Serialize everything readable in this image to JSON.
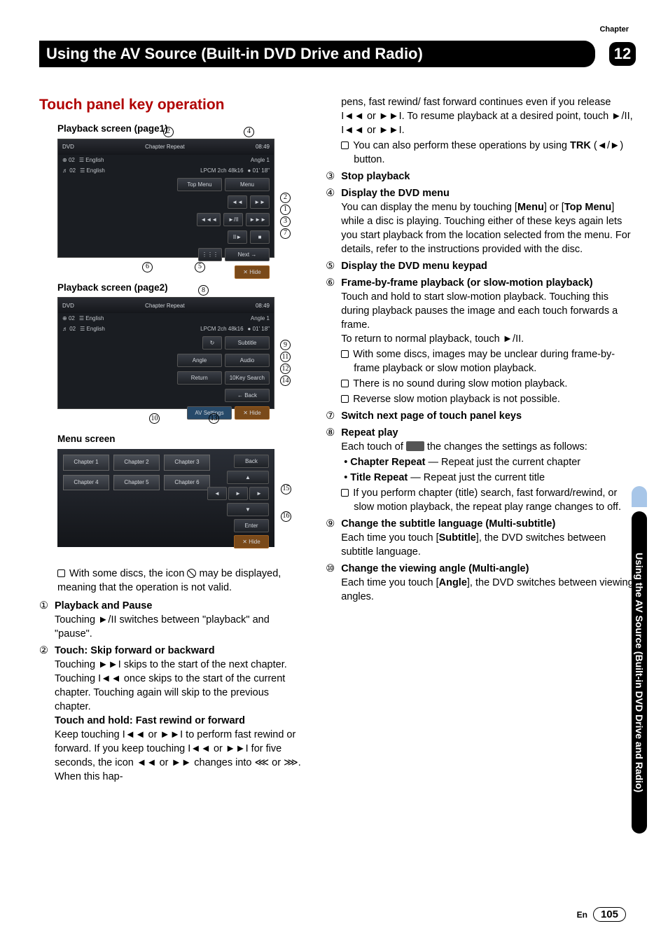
{
  "chapterLabel": "Chapter",
  "chapterNum": "12",
  "headerTitle": "Using the AV Source (Built-in DVD Drive and Radio)",
  "sectionTitle": "Touch panel key operation",
  "captions": {
    "p1": "Playback screen (page1)",
    "p2": "Playback screen (page2)",
    "menu": "Menu screen"
  },
  "panel1": {
    "dvd": "DVD",
    "c1a": "02",
    "c1b": "English",
    "c2a": "02",
    "c2b": "English",
    "chapter": "Chapter",
    "repeat": "Repeat",
    "time": "08:49",
    "angle": "Angle 1",
    "codec": "LPCM 2ch 48k16",
    "dur": "01' 18\"",
    "topmenu": "Top Menu",
    "menu": "Menu",
    "prev": "◄◄",
    "next": "►►",
    "rew": "◄◄◄",
    "play": "►/II",
    "fwd": "►►►",
    "slow": "II►",
    "stop": "■",
    "keypad": "⋮⋮⋮",
    "nextpage": "Next →",
    "hide": "✕ Hide"
  },
  "panel2": {
    "subtitle": "Subtitle",
    "angleBtn": "Angle",
    "audio": "Audio",
    "return": "Return",
    "search": "10Key Search",
    "back": "← Back",
    "av": "AV Settings",
    "hide": "✕ Hide",
    "repeatBtn": "↻"
  },
  "menuPanel": {
    "c1": "Chapter\n1",
    "c2": "Chapter\n2",
    "c3": "Chapter\n3",
    "c4": "Chapter\n4",
    "c5": "Chapter\n5",
    "c6": "Chapter\n6",
    "back": "Back",
    "enter": "Enter",
    "hide": "✕ Hide",
    "up": "▲",
    "down": "▼",
    "left": "◄",
    "right": "►",
    "ok": "►"
  },
  "leftBody": {
    "invalid": "With some discs, the icon ",
    "invalid2": " may be displayed, meaning that the operation is not valid.",
    "i1t": "Playback and Pause",
    "i1b": "Touching ►/II switches between \"playback\" and \"pause\".",
    "i2t": "Touch: Skip forward or backward",
    "i2b1": "Touching ►►I skips to the start of the next chapter. Touching I◄◄ once skips to the start of the current chapter. Touching again will skip to the previous chapter.",
    "i2t2": "Touch and hold: Fast rewind or forward",
    "i2b2": "Keep touching I◄◄ or ►►I to perform fast rewind or forward. If you keep touching I◄◄ or ►►I for five seconds, the icon ◄◄ or ►► changes into ⋘ or ⋙. When this hap-"
  },
  "rightBody": {
    "cont": "pens, fast rewind/ fast forward continues even if you release I◄◄ or ►►I. To resume playback at a desired point, touch ►/II, I◄◄ or ►►I.",
    "trk": "You can also perform these operations by using ",
    "trkB": "TRK",
    "trk2": " (◄/►) button.",
    "i3": "Stop playback",
    "i4t": "Display the DVD menu",
    "i4b": "You can display the menu by touching [",
    "i4menu": "Menu",
    "i4mid": "] or [",
    "i4top": "Top Menu",
    "i4b2": "] while a disc is playing. Touching either of these keys again lets you start playback from the location selected from the menu. For details, refer to the instructions provided with the disc.",
    "i5": "Display the DVD menu keypad",
    "i6t": "Frame-by-frame playback (or slow-motion playback)",
    "i6b": "Touch and hold to start slow-motion playback. Touching this during playback pauses the image and each touch forwards a frame.",
    "i6b2": "To return to normal playback, touch ►/II.",
    "i6s1": "With some discs, images may be unclear during frame-by-frame playback or slow motion playback.",
    "i6s2": "There is no sound during slow motion playback.",
    "i6s3": "Reverse slow motion playback is not possible.",
    "i7": "Switch next page of touch panel keys",
    "i8t": "Repeat play",
    "i8b": "Each touch of ",
    "i8b2": " the changes the settings as follows:",
    "i8c1": "Chapter Repeat",
    "i8c1b": " — Repeat just the current chapter",
    "i8c2": "Title Repeat",
    "i8c2b": " — Repeat just the current title",
    "i8s": "If you perform chapter (title) search, fast forward/rewind, or slow motion playback, the repeat play range changes to off.",
    "i9t": "Change the subtitle language (Multi-subtitle)",
    "i9b": "Each time you touch [",
    "i9sub": "Subtitle",
    "i9b2": "], the DVD switches between subtitle language.",
    "i10t": "Change the viewing angle (Multi-angle)",
    "i10b": "Each time you touch [",
    "i10ang": "Angle",
    "i10b2": "], the DVD switches between viewing angles."
  },
  "sideTab": "Using the AV Source (Built-in DVD Drive and Radio)",
  "footer": {
    "lang": "En",
    "page": "105"
  },
  "circled": [
    "①",
    "②",
    "③",
    "④",
    "⑤",
    "⑥",
    "⑦",
    "⑧",
    "⑨",
    "⑩",
    "⑪",
    "⑫",
    "⑬",
    "⑭",
    "⑮",
    "⑯"
  ]
}
